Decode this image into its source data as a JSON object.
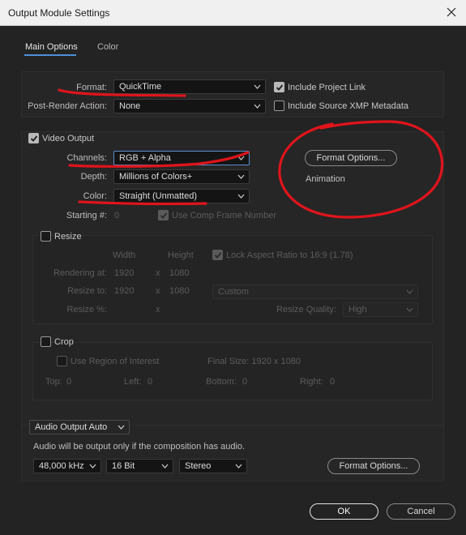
{
  "window": {
    "title": "Output Module Settings"
  },
  "tabs": [
    {
      "label": "Main Options",
      "active": true
    },
    {
      "label": "Color",
      "active": false
    }
  ],
  "top": {
    "format_label": "Format:",
    "format_value": "QuickTime",
    "include_project_link": {
      "label": "Include Project Link",
      "checked": true
    },
    "post_render_label": "Post-Render Action:",
    "post_render_value": "None",
    "include_xmp": {
      "label": "Include Source XMP Metadata",
      "checked": false
    }
  },
  "video": {
    "header": {
      "label": "Video Output",
      "checked": true
    },
    "channels_label": "Channels:",
    "channels_value": "RGB + Alpha",
    "depth_label": "Depth:",
    "depth_value": "Millions of Colors+",
    "color_label": "Color:",
    "color_value": "Straight (Unmatted)",
    "starting_label": "Starting #:",
    "starting_value": "0",
    "use_comp_frame": {
      "label": "Use Comp Frame Number",
      "checked": true
    },
    "format_options_label": "Format Options...",
    "codec_text": "Animation"
  },
  "resize": {
    "header": {
      "label": "Resize",
      "checked": false
    },
    "width_header": "Width",
    "height_header": "Height",
    "lock_aspect": {
      "label": "Lock Aspect Ratio to 16:9 (1.78)",
      "checked": true
    },
    "rendering_at_label": "Rendering at:",
    "rendering_w": "1920",
    "rendering_h": "1080",
    "resize_to_label": "Resize to:",
    "resize_w": "1920",
    "resize_h": "1080",
    "preset_value": "Custom",
    "resize_pct_label": "Resize %:",
    "x_sep": "x",
    "quality_label": "Resize Quality:",
    "quality_value": "High"
  },
  "crop": {
    "header": {
      "label": "Crop",
      "checked": false
    },
    "use_roi": {
      "label": "Use Region of Interest",
      "checked": false
    },
    "final_size": "Final Size: 1920 x 1080",
    "top_label": "Top:",
    "top_value": "0",
    "left_label": "Left:",
    "left_value": "0",
    "bottom_label": "Bottom:",
    "bottom_value": "0",
    "right_label": "Right:",
    "right_value": "0"
  },
  "audio": {
    "mode_value": "Audio Output Auto",
    "note": "Audio will be output only if the composition has audio.",
    "rate_value": "48,000 kHz",
    "bits_value": "16 Bit",
    "channels_value": "Stereo",
    "format_options_label": "Format Options..."
  },
  "footer": {
    "ok_label": "OK",
    "cancel_label": "Cancel"
  },
  "colors": {
    "background": "#232323",
    "accent_blue": "#4e8fd6",
    "annotation_red": "#e0141b"
  }
}
